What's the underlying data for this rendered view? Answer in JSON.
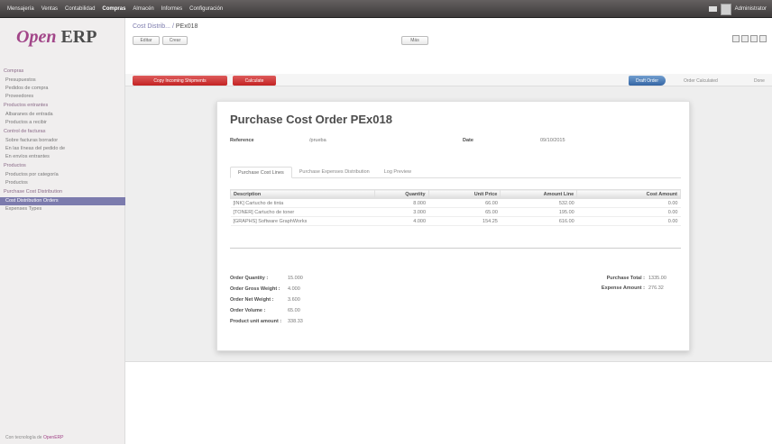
{
  "topbar": {
    "menu": [
      "Mensajería",
      "Ventas",
      "Contabilidad",
      "Compras",
      "Almacén",
      "Informes",
      "Configuración"
    ],
    "active_menu": "Compras",
    "user": "Administrator"
  },
  "sidebar": {
    "logo_open": "Open",
    "logo_erp": "ERP",
    "sections": [
      {
        "title": "Compras",
        "items": [
          "Presupuestos",
          "Pedidos de compra",
          "Proveedores"
        ]
      },
      {
        "title": "Productos entrantes",
        "items": [
          "Albaranes de entrada",
          "Productos a recibir"
        ]
      },
      {
        "title": "Control de facturas",
        "items": [
          "Sobre facturas borrador",
          "En las líneas del pedido de",
          "En envíos entrantes"
        ]
      },
      {
        "title": "Productos",
        "items": [
          "Productos por categoría",
          "Productos"
        ]
      },
      {
        "title": "Purchase Cost Distribution",
        "items": [
          "Cost Distribution Orders",
          "Expenses Types"
        ]
      }
    ],
    "active_item": "Cost Distribution Orders",
    "powered_prefix": "Con tecnología de",
    "powered_brand": "OpenERP"
  },
  "header": {
    "breadcrumb_parent": "Cost Distrib...",
    "breadcrumb_sep": "/",
    "breadcrumb_current": "PEx018",
    "edit_label": "Editar",
    "create_label": "Crear",
    "more_label": "Más"
  },
  "actions": {
    "copy_label": "Copy Incoming Shipments",
    "calculate_label": "Calculate",
    "states": [
      "Draft Order",
      "Order Calculated",
      "Done"
    ],
    "active_state": "Draft Order"
  },
  "form": {
    "title": "Purchase Cost Order PEx018",
    "reference_label": "Reference",
    "reference_value": "/prueba",
    "date_label": "Date",
    "date_value": "09/10/2015",
    "tabs": [
      "Purchase Cost Lines",
      "Purchase Expenses Distribution",
      "Log Preview"
    ],
    "active_tab": "Purchase Cost Lines",
    "columns": [
      "Description",
      "Quantity",
      "Unit Price",
      "Amount Line",
      "Cost Amount"
    ],
    "rows": [
      [
        "[INK] Cartucho de tinta",
        "8.000",
        "66.00",
        "532.00",
        "0.00"
      ],
      [
        "[TONER] Cartucho de toner",
        "3.000",
        "65.00",
        "195.00",
        "0.00"
      ],
      [
        "[GRAPHS] Software GraphWorks",
        "4.000",
        "154.25",
        "616.00",
        "0.00"
      ]
    ],
    "totals_left": [
      {
        "label": "Order Quantity :",
        "value": "15.000"
      },
      {
        "label": "Order Gross Weight :",
        "value": "4.000"
      },
      {
        "label": "Order Net Weight :",
        "value": "3.600"
      },
      {
        "label": "Order Volume :",
        "value": "65.00"
      },
      {
        "label": "Product unit amount :",
        "value": "338.33"
      }
    ],
    "totals_right": [
      {
        "label": "Purchase Total :",
        "value": "1335.00"
      },
      {
        "label": "Expense Amount :",
        "value": "276.32"
      }
    ]
  }
}
